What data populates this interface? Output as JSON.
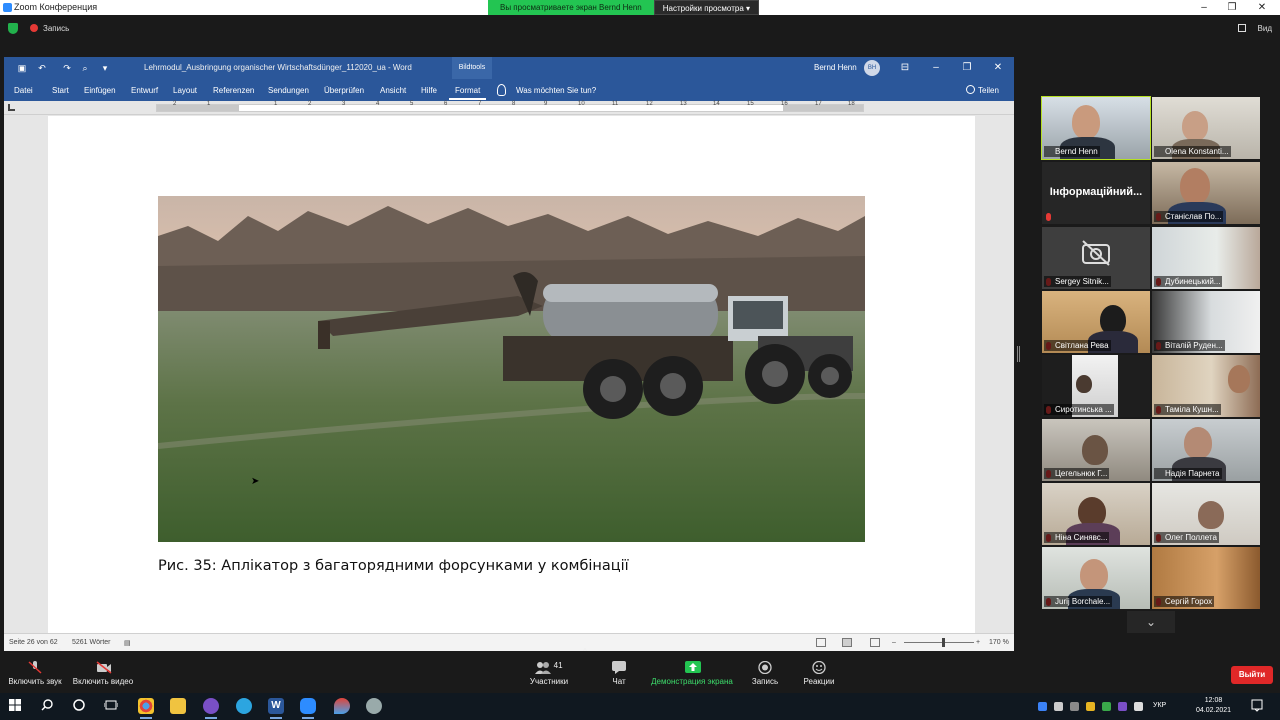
{
  "zoom": {
    "window_title": "Zoom Конференция",
    "share_banner": "Вы просматриваете экран Bernd Henn",
    "view_settings": "Настройки просмотра",
    "recording_label": "Запись",
    "view_label": "Вид",
    "controls": {
      "unmute": "Включить звук",
      "start_video": "Включить видео",
      "participants": "Участники",
      "participants_count": "41",
      "chat": "Чат",
      "share_screen": "Демонстрация экрана",
      "record": "Запись",
      "reactions": "Реакции",
      "end": "Выйти"
    },
    "participants": [
      {
        "name": "Bernd Henn",
        "mic_muted": false
      },
      {
        "name": "Olena Konstanti...",
        "mic_muted": false
      },
      {
        "name": "Інформаційний...",
        "mic_muted": true,
        "video_off": true
      },
      {
        "name": "Станіслав По...",
        "mic_muted": true
      },
      {
        "name": "Sergey Sitnik...",
        "mic_muted": true,
        "camera_off": true
      },
      {
        "name": "Дубинецький...",
        "mic_muted": true
      },
      {
        "name": "Світлана Рева",
        "mic_muted": true
      },
      {
        "name": "Віталій Руден...",
        "mic_muted": true
      },
      {
        "name": "Сиротинська ...",
        "mic_muted": true
      },
      {
        "name": "Таміла Кушн...",
        "mic_muted": true
      },
      {
        "name": "Цегельнюк Г...",
        "mic_muted": true
      },
      {
        "name": "Надія Парнета",
        "mic_muted": false
      },
      {
        "name": "Ніна Синявс...",
        "mic_muted": true
      },
      {
        "name": "Олег Поллета",
        "mic_muted": true
      },
      {
        "name": "Jurij Borchale...",
        "mic_muted": true
      },
      {
        "name": "Сергій Горох",
        "mic_muted": true
      }
    ]
  },
  "word": {
    "doc_title": "Lehrmodul_Ausbringung organischer Wirtschaftsdünger_112020_ua  -  Word",
    "contextual_tab": "Bildtools",
    "user_name": "Bernd Henn",
    "user_initials": "BH",
    "tabs": [
      "Datei",
      "Start",
      "Einfügen",
      "Entwurf",
      "Layout",
      "Referenzen",
      "Sendungen",
      "Überprüfen",
      "Ansicht",
      "Hilfe",
      "Format"
    ],
    "tell_me": "Was möchten Sie tun?",
    "share": "Teilen",
    "ruler_numbers": [
      "2",
      "1",
      "1",
      "2",
      "3",
      "4",
      "5",
      "6",
      "7",
      "8",
      "9",
      "10",
      "11",
      "12",
      "13",
      "14",
      "15",
      "16",
      "17",
      "18"
    ],
    "caption": "Рис. 35: Аплікатор з багаторядними форсунками у комбінації",
    "status": {
      "page": "Seite 26 von 62",
      "words": "5261 Wörter",
      "zoom": "170 %"
    }
  },
  "taskbar": {
    "language": "УКР",
    "time": "12:08",
    "date": "04.02.2021"
  }
}
